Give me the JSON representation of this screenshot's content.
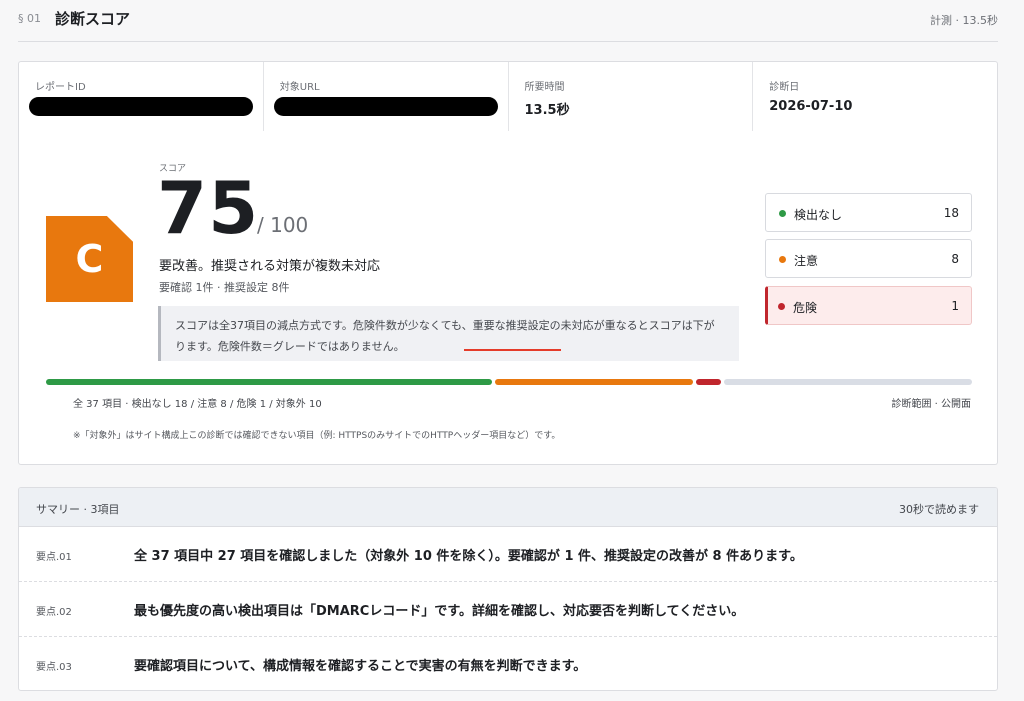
{
  "header": {
    "section_num": "§ 01",
    "title": "診断スコア",
    "measure": "計測 · 13.5秒"
  },
  "meta": [
    {
      "label": "レポートID",
      "value": "",
      "redacted": true
    },
    {
      "label": "対象URL",
      "value": "",
      "redacted": true
    },
    {
      "label": "所要時間",
      "value": "13.5秒",
      "redacted": false
    },
    {
      "label": "診断日",
      "value": "2026-07-10",
      "redacted": false
    }
  ],
  "score": {
    "grade": "C",
    "label": "スコア",
    "value": "75",
    "max": "/ 100",
    "verdict": "要改善。推奨される対策が複数未対応",
    "counts": "要確認 1件 · 推奨設定 8件",
    "note": "スコアは全37項目の減点方式です。危険件数が少なくても、重要な推奨設定の未対応が重なるとスコアは下がります。危険件数＝グレードではありません。"
  },
  "status": [
    {
      "label": "検出なし",
      "count": "18",
      "color": "#2e9a46"
    },
    {
      "label": "注意",
      "count": "8",
      "color": "#e8780e"
    },
    {
      "label": "危険",
      "count": "1",
      "color": "#c0262d"
    }
  ],
  "breakdown": {
    "total": 37,
    "ok": 18,
    "warn": 8,
    "danger": 1,
    "na": 10,
    "colors": {
      "ok": "#2e9a46",
      "warn": "#e8780e",
      "danger": "#c0262d",
      "na": "#d9dde5"
    },
    "summary_text": "全 37 項目 · 検出なし 18 / 注意 8 / 危険 1 / 対象外 10",
    "scope": "診断範囲 · 公開面",
    "footnote": "※「対象外」はサイト構成上この診断では確認できない項目（例: HTTPSのみサイトでのHTTPヘッダー項目など）です。"
  },
  "summary": {
    "title": "サマリー · 3項目",
    "read_time": "30秒で読めます",
    "items": [
      {
        "num": "要点.01",
        "text": "全 37 項目中 27 項目を確認しました（対象外 10 件を除く）。要確認が 1 件、推奨設定の改善が 8 件あります。"
      },
      {
        "num": "要点.02",
        "text": "最も優先度の高い検出項目は「DMARCレコード」です。詳細を確認し、対応要否を判断してください。"
      },
      {
        "num": "要点.03",
        "text": "要確認項目について、構成情報を確認することで実害の有無を判断できます。"
      }
    ]
  }
}
